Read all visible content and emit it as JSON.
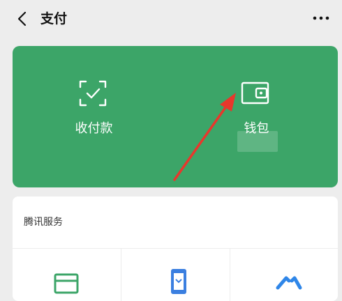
{
  "header": {
    "title": "支付"
  },
  "card": {
    "receive_pay_label": "收付款",
    "wallet_label": "钱包"
  },
  "services": {
    "section_title": "腾讯服务"
  },
  "colors": {
    "card_green": "#3ca568",
    "annotation_red": "#e8372c",
    "background": "#ededed"
  }
}
